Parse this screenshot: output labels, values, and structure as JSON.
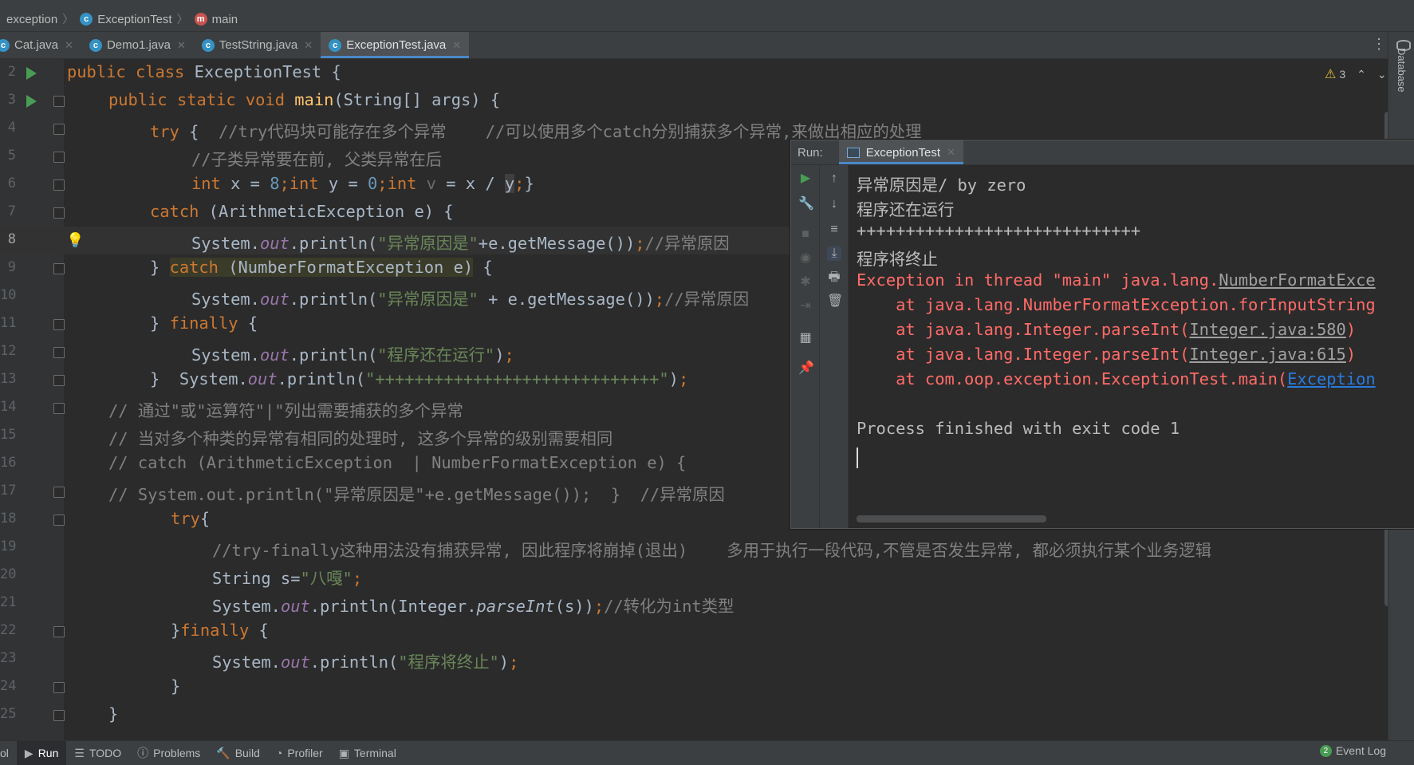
{
  "breadcrumb": {
    "project": "exception",
    "class": "ExceptionTest",
    "method": "main"
  },
  "tabs": [
    {
      "label": "Cat.java"
    },
    {
      "label": "Demo1.java"
    },
    {
      "label": "TestString.java"
    },
    {
      "label": "ExceptionTest.java"
    }
  ],
  "inspections": {
    "warning_count": "3"
  },
  "right_sidebar": {
    "database_label": "Database"
  },
  "line_numbers": [
    "2",
    "3",
    "4",
    "5",
    "6",
    "7",
    "8",
    "9",
    "10",
    "11",
    "12",
    "13",
    "14",
    "15",
    "16",
    "17",
    "18",
    "19",
    "20",
    "21",
    "22",
    "23",
    "24",
    "25"
  ],
  "code": {
    "l2": [
      "public ",
      "class ",
      "ExceptionTest {"
    ],
    "l3": [
      "public ",
      "static ",
      "void ",
      "main",
      "(String[] args) {"
    ],
    "l4": [
      "try ",
      "{  ",
      "//try代码块可能存在多个异常    //可以使用多个catch分别捕获多个异常,来做出相应的处理"
    ],
    "l5": [
      "//子类异常要在前, 父类异常在后"
    ],
    "l6": [
      "int ",
      "x = ",
      "8",
      ";",
      "int ",
      "y = ",
      "0",
      ";",
      "int ",
      "v",
      " = x / ",
      "y",
      ";",
      "}"
    ],
    "l7": [
      "catch ",
      "(ArithmeticException e) {"
    ],
    "l8": [
      "System.",
      "out",
      ".println(",
      "\"异常原因是\"",
      "+e.getMessage())",
      ";",
      "//异常原因"
    ],
    "l9": [
      "} ",
      "catch ",
      "(NumberFormatException e)",
      " {"
    ],
    "l10": [
      "System.",
      "out",
      ".println(",
      "\"异常原因是\"",
      " + e.getMessage())",
      ";",
      "//异常原因"
    ],
    "l11": [
      "} ",
      "finally ",
      "{"
    ],
    "l12": [
      "System.",
      "out",
      ".println(",
      "\"程序还在运行\"",
      ")",
      ";"
    ],
    "l13": [
      "}  System.",
      "out",
      ".println(",
      "\"+++++++++++++++++++++++++++++\"",
      ")",
      ";"
    ],
    "l14": [
      "// 通过\"或\"运算符\"|\"列出需要捕获的多个异常"
    ],
    "l15": [
      "// 当对多个种类的异常有相同的处理时, 这多个异常的级别需要相同"
    ],
    "l16": [
      "// catch (ArithmeticException  | NumberFormatException e) {"
    ],
    "l17": [
      "// System.out.println(\"异常原因是\"+e.getMessage());  }  //异常原因"
    ],
    "l18": [
      "try",
      "{"
    ],
    "l19": [
      "//try-finally这种用法没有捕获异常, 因此程序将崩掉(退出)    多用于执行一段代码,不管是否发生异常, 都必须执行某个业务逻辑"
    ],
    "l20": [
      "String s=",
      "\"八嘎\"",
      ";"
    ],
    "l21": [
      "System.",
      "out",
      ".println(Integer.",
      "parseInt",
      "(s))",
      ";",
      "//转化为int类型"
    ],
    "l22": [
      "}",
      "finally ",
      "{"
    ],
    "l23": [
      "System.",
      "out",
      ".println(",
      "\"程序将终止\"",
      ")",
      ";"
    ],
    "l24": [
      "}"
    ],
    "l25": [
      "}"
    ]
  },
  "run": {
    "label": "Run:",
    "tab": "ExceptionTest",
    "output": {
      "o1": "异常原因是/ by zero",
      "o2": "程序还在运行",
      "o3": "+++++++++++++++++++++++++++++",
      "o4": "程序将终止",
      "e1a": "Exception in thread \"main\" java.lang.",
      "e1b": "NumberFormatExce",
      "e2": "    at java.lang.NumberFormatException.forInputString",
      "e3a": "    at java.lang.Integer.parseInt(",
      "e3b": "Integer.java:580",
      "e3c": ")",
      "e4a": "    at java.lang.Integer.parseInt(",
      "e4b": "Integer.java:615",
      "e4c": ")",
      "e5a": "    at com.oop.exception.ExceptionTest.main(",
      "e5b": "Exception",
      "fin": "Process finished with exit code 1"
    }
  },
  "statusbar": {
    "left_cut": "ol",
    "run": "Run",
    "todo": "TODO",
    "problems": "Problems",
    "build": "Build",
    "profiler": "Profiler",
    "terminal": "Terminal",
    "event_log_count": "2",
    "event_log": "Event Log"
  }
}
